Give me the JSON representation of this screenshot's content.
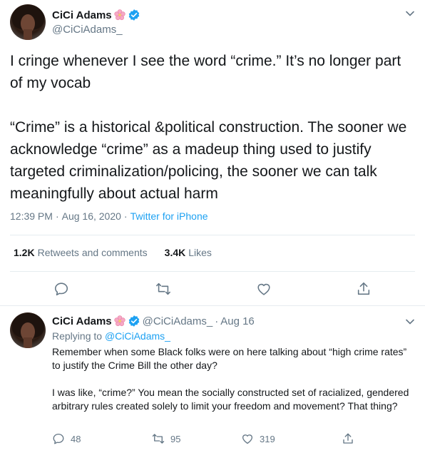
{
  "main_tweet": {
    "author": {
      "display_name": "CiCi Adams",
      "handle": "@CiCiAdams_",
      "verified": true,
      "name_emoji": "cherry-blossom-icon"
    },
    "text": "I cringe whenever I see the word “crime.” It’s no longer part of my vocab\n\n“Crime” is a historical &political construction. The sooner we acknowledge “crime” as a madeup thing used to justify targeted criminalization/policing, the sooner we can talk meaningfully about actual harm",
    "time": "12:39 PM",
    "date": "Aug 16, 2020",
    "separator": "·",
    "source": "Twitter for iPhone",
    "stats": {
      "retweets_count": "1.2K",
      "retweets_label": "Retweets and comments",
      "likes_count": "3.4K",
      "likes_label": "Likes"
    },
    "actions": [
      "reply-icon",
      "retweet-icon",
      "like-icon",
      "share-icon"
    ]
  },
  "reply_tweet": {
    "author": {
      "display_name": "CiCi Adams",
      "handle": "@CiCiAdams_",
      "verified": true,
      "name_emoji": "cherry-blossom-icon"
    },
    "separator": "·",
    "date": "Aug 16",
    "replying_prefix": "Replying to",
    "replying_handle": "@CiCiAdams_",
    "text": "Remember when some Black folks were on here talking about “high crime rates” to justify the Crime Bill the other day?\n\nI was like, “crime?” You mean the socially constructed set of racialized, gendered arbitrary rules created solely to limit your freedom and movement? That thing?",
    "stats": {
      "replies": "48",
      "retweets": "95",
      "likes": "319"
    }
  },
  "colors": {
    "accent": "#1da1f2",
    "text_primary": "#14171a",
    "text_secondary": "#657786",
    "divider": "#e6ecf0"
  }
}
